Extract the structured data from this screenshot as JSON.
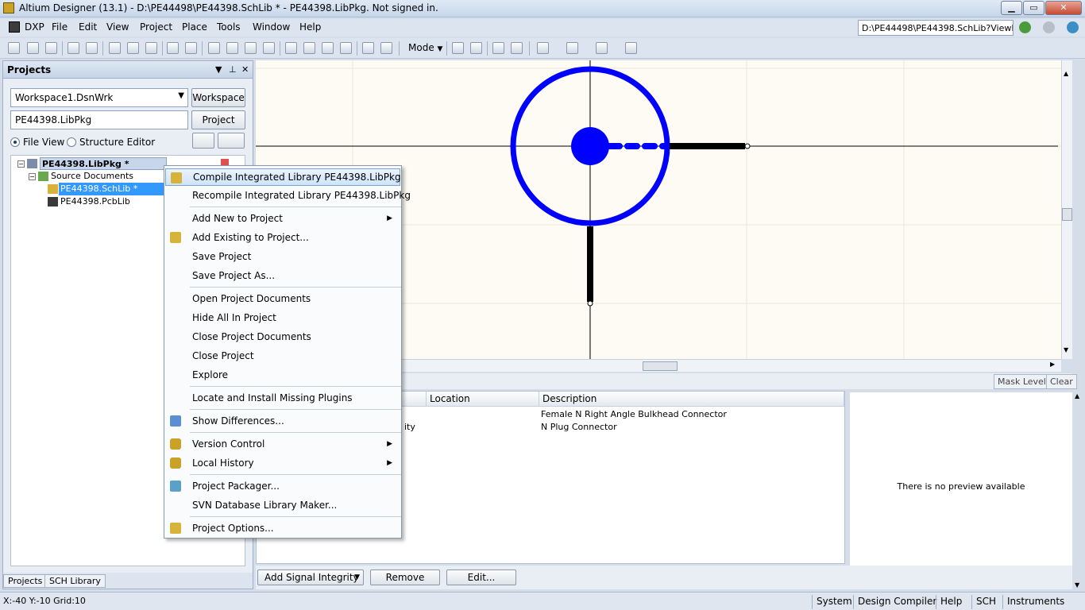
{
  "window": {
    "title": "Altium Designer (13.1) - D:\\PE44498\\PE44398.SchLib * - PE44398.LibPkg. Not signed in.",
    "minimize": "▁",
    "maximize": "▭",
    "close": "✕"
  },
  "menubar": {
    "items": [
      "DXP",
      "File",
      "Edit",
      "View",
      "Project",
      "Place",
      "Tools",
      "Window",
      "Help"
    ],
    "path": "D:\\PE44498\\PE44398.SchLib?ViewN"
  },
  "toolbar": {
    "mode_label": "Mode"
  },
  "projects_panel": {
    "title": "Projects",
    "workspace_value": "Workspace1.DsnWrk",
    "workspace_button": "Workspace",
    "project_value": "PE44398.LibPkg",
    "project_button": "Project",
    "file_view_label": "File View",
    "structure_editor_label": "Structure Editor",
    "tree": {
      "root": "PE44398.LibPkg *",
      "folder": "Source Documents",
      "doc1": "PE44398.SchLib *",
      "doc2": "PE44398.PcbLib"
    },
    "tabs": [
      "Projects",
      "SCH Library"
    ]
  },
  "models_grid": {
    "headers": [
      "Location",
      "Description"
    ],
    "rows": [
      {
        "fragment": "",
        "description": "Female N Right Angle Bulkhead Connector"
      },
      {
        "fragment": "ity",
        "description": "N Plug Connector"
      }
    ]
  },
  "mask": {
    "mask_level": "Mask Level",
    "clear": "Clear"
  },
  "preview": {
    "text": "There is no preview available"
  },
  "bottom_buttons": {
    "add_signal_integrity": "Add Signal Integrity",
    "remove": "Remove",
    "edit": "Edit..."
  },
  "statusbar": {
    "coords": "X:-40 Y:-10   Grid:10",
    "tabs": [
      "System",
      "Design Compiler",
      "Help",
      "SCH",
      "Instruments"
    ]
  },
  "context_menu": {
    "items": [
      "Compile Integrated Library PE44398.LibPkg",
      "Recompile Integrated Library PE44398.LibPkg",
      "Add New to Project",
      "Add Existing to Project...",
      "Save Project",
      "Save Project As...",
      "Open Project Documents",
      "Hide All In Project",
      "Close Project Documents",
      "Close Project",
      "Explore",
      "Locate and Install Missing Plugins",
      "Show Differences...",
      "Version Control",
      "Local History",
      "Project Packager...",
      "SVN Database Library Maker...",
      "Project Options..."
    ]
  },
  "colors": {
    "accent": "#0000ff",
    "highlight": "#cfe4fa",
    "selection": "#3399ff"
  }
}
